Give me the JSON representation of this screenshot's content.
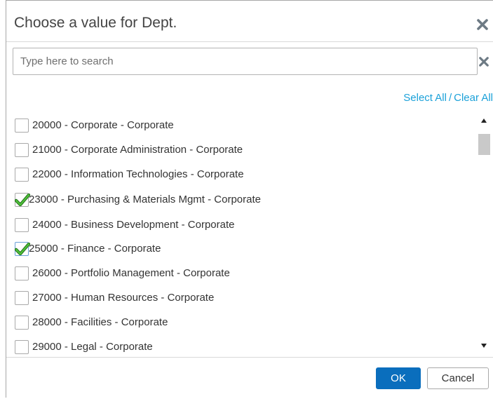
{
  "dialog": {
    "title": "Choose a value for Dept.",
    "close_icon": "close-icon",
    "search": {
      "placeholder": "Type here to search",
      "value": ""
    },
    "clear_icon": "clear-search-icon",
    "select_all_label": "Select All",
    "separator": "/",
    "clear_all_label": "Clear All",
    "items": [
      {
        "label": "20000 - Corporate - Corporate",
        "checked": false
      },
      {
        "label": "21000 - Corporate Administration - Corporate",
        "checked": false
      },
      {
        "label": "22000 - Information Technologies - Corporate",
        "checked": false
      },
      {
        "label": "23000 - Purchasing & Materials Mgmt - Corporate",
        "checked": true
      },
      {
        "label": "24000 - Business Development - Corporate",
        "checked": false
      },
      {
        "label": "25000 - Finance - Corporate",
        "checked": true
      },
      {
        "label": "26000 - Portfolio Management - Corporate",
        "checked": false
      },
      {
        "label": "27000 - Human Resources - Corporate",
        "checked": false
      },
      {
        "label": "28000 - Facilities - Corporate",
        "checked": false
      },
      {
        "label": "29000 - Legal - Corporate",
        "checked": false
      }
    ],
    "ok_label": "OK",
    "cancel_label": "Cancel"
  },
  "colors": {
    "accent_blue": "#0a6ebd",
    "link_blue": "#1ba1d9",
    "check_green": "#3aa12a",
    "icon_gray": "#6d7a84"
  }
}
